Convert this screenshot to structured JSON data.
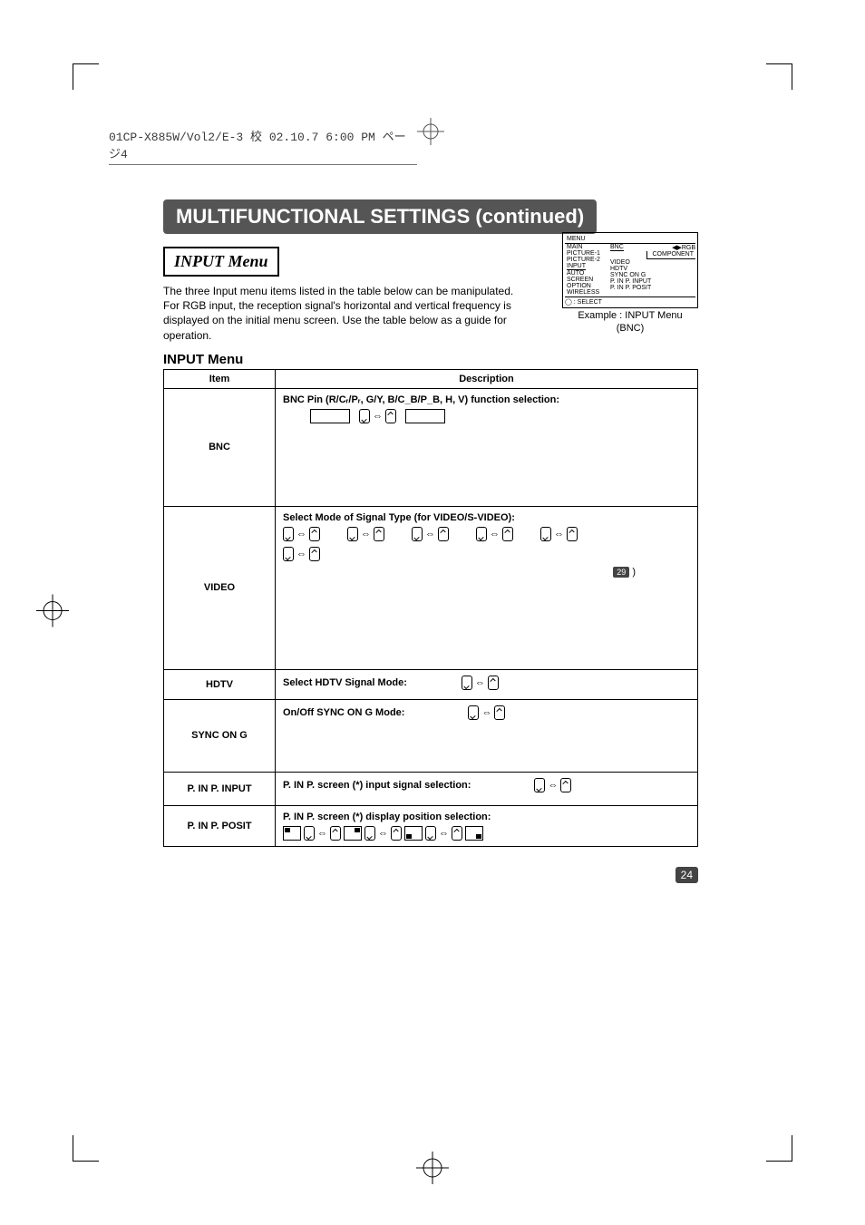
{
  "slugline": "01CP-X885W/Vol2/E-3  校 02.10.7 6:00 PM  ページ4",
  "banner": "MULTIFUNCTIONAL SETTINGS (continued)",
  "subtitle": "INPUT Menu",
  "intro": "The three Input menu items listed in the table below can be manipulated. For RGB input, the reception signal's horizontal and vertical frequency is displayed on the initial menu screen. Use the table below as a guide for operation.",
  "menu_fig": {
    "title": "MENU",
    "left": [
      "MAIN",
      "PICTURE-1",
      "PICTURE-2",
      "INPUT",
      "AUTO",
      "SCREEN",
      "OPTION",
      "WIRELESS"
    ],
    "right_top": [
      "BNC",
      "◀▶RGB"
    ],
    "right_sub": "COMPONENT",
    "right_rest": [
      "VIDEO",
      "HDTV",
      "SYNC ON G",
      "P. IN P. INPUT",
      "P. IN P. POSIT"
    ],
    "footer": "◯ : SELECT",
    "caption1": "Example : INPUT Menu",
    "caption2": "(BNC)"
  },
  "section_head": "INPUT Menu",
  "table": {
    "head_item": "Item",
    "head_desc": "Description",
    "rows": [
      {
        "item": "BNC",
        "title": "BNC Pin (R/Cᵣ/Pᵣ, G/Y, B/C_B/P_B, H, V) function selection:"
      },
      {
        "item": "VIDEO",
        "title": "Select Mode of Signal Type (for VIDEO/S-VIDEO):",
        "ref": "29"
      },
      {
        "item": "HDTV",
        "title": "Select HDTV Signal Mode:"
      },
      {
        "item": "SYNC ON G",
        "title": "On/Off SYNC ON G Mode:"
      },
      {
        "item": "P. IN P. INPUT",
        "title": "P. IN P. screen (*) input signal selection:"
      },
      {
        "item": "P. IN P. POSIT",
        "title": "P. IN P. screen (*) display position selection:"
      }
    ]
  },
  "page_number": "24"
}
